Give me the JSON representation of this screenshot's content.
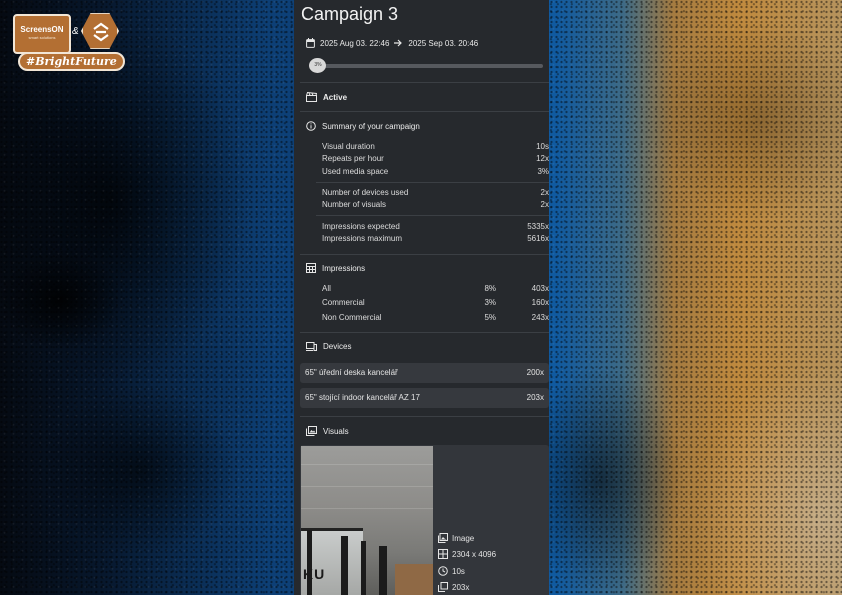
{
  "logo": {
    "brand": "ScreensON",
    "brand_sub": "smart solutions",
    "amp": "&",
    "tagline": "#BrightFuture"
  },
  "campaign": {
    "title": "Campaign 3",
    "start": "2025 Aug 03. 22:46",
    "end": "2025 Sep 03. 20:46",
    "progress_label": "3%",
    "progress_value": 0.03,
    "status": "Active"
  },
  "summary": {
    "heading": "Summary of your campaign",
    "rows": [
      {
        "label": "Visual duration",
        "value": "10s"
      },
      {
        "label": "Repeats per hour",
        "value": "12x"
      },
      {
        "label": "Used media space",
        "value": "3%"
      },
      {
        "label": "Number of devices used",
        "value": "2x"
      },
      {
        "label": "Number of visuals",
        "value": "2x"
      },
      {
        "label": "Impressions expected",
        "value": "5335x"
      },
      {
        "label": "Impressions maximum",
        "value": "5616x"
      }
    ]
  },
  "impressions": {
    "heading": "Impressions",
    "rows": [
      {
        "label": "All",
        "percent": "8%",
        "value": "403x"
      },
      {
        "label": "Commercial",
        "percent": "3%",
        "value": "160x"
      },
      {
        "label": "Non Commercial",
        "percent": "5%",
        "value": "243x"
      }
    ]
  },
  "devices": {
    "heading": "Devices",
    "items": [
      {
        "name": "65\" úřední deska kancelář",
        "value": "200x"
      },
      {
        "name": "65\" stojící indoor kancelář AZ 17",
        "value": "203x"
      }
    ]
  },
  "visuals": {
    "heading": "Visuals",
    "items": [
      {
        "type": "Image",
        "resolution": "2304 x 4096",
        "duration": "10s",
        "count": "203x",
        "thumb_text": "KU"
      }
    ]
  },
  "icons": {
    "calendar": "calendar-icon",
    "arrow": "arrow-right-icon",
    "status": "clapperboard-icon",
    "summary": "info-icon",
    "impressions": "grid-icon",
    "devices": "devices-icon",
    "visuals": "gallery-icon"
  }
}
